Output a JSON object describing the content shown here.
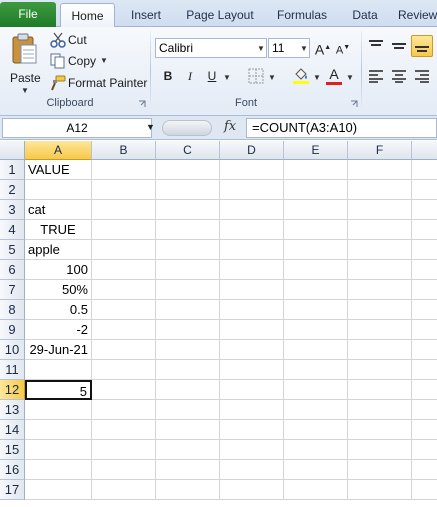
{
  "tabs": [
    {
      "label": "File"
    },
    {
      "label": "Home"
    },
    {
      "label": "Insert"
    },
    {
      "label": "Page Layout"
    },
    {
      "label": "Formulas"
    },
    {
      "label": "Data"
    },
    {
      "label": "Review"
    }
  ],
  "clipboard": {
    "paste_label": "Paste",
    "cut_label": "Cut",
    "copy_label": "Copy",
    "format_painter_label": "Format Painter",
    "group_label": "Clipboard"
  },
  "font": {
    "font_name": "Calibri",
    "font_size": "11",
    "group_label": "Font",
    "bold": "B",
    "italic": "I",
    "underline": "U",
    "grow": "A",
    "shrink": "A",
    "font_color_letter": "A"
  },
  "colors": {
    "file_tab": "#2a8a33",
    "selection_header": "#f7c94a",
    "fill_yellow": "#ffff00",
    "font_red": "#e02020"
  },
  "formula_bar": {
    "name_box": "A12",
    "fx_label": "fx",
    "formula": "=COUNT(A3:A10)"
  },
  "columns": [
    "A",
    "B",
    "C",
    "D",
    "E",
    "F"
  ],
  "rows": [
    {
      "num": "1",
      "a": "VALUE",
      "align": "left"
    },
    {
      "num": "2",
      "a": "",
      "align": "left"
    },
    {
      "num": "3",
      "a": "cat",
      "align": "left"
    },
    {
      "num": "4",
      "a": "TRUE",
      "align": "center"
    },
    {
      "num": "5",
      "a": "apple",
      "align": "left"
    },
    {
      "num": "6",
      "a": "100",
      "align": "right"
    },
    {
      "num": "7",
      "a": "50%",
      "align": "right"
    },
    {
      "num": "8",
      "a": "0.5",
      "align": "right"
    },
    {
      "num": "9",
      "a": "-2",
      "align": "right"
    },
    {
      "num": "10",
      "a": "29-Jun-21",
      "align": "right"
    },
    {
      "num": "11",
      "a": "",
      "align": "left"
    },
    {
      "num": "12",
      "a": "5",
      "align": "right"
    },
    {
      "num": "13",
      "a": "",
      "align": "left"
    },
    {
      "num": "14",
      "a": "",
      "align": "left"
    },
    {
      "num": "15",
      "a": "",
      "align": "left"
    },
    {
      "num": "16",
      "a": "",
      "align": "left"
    },
    {
      "num": "17",
      "a": "",
      "align": "left"
    }
  ],
  "active_cell": {
    "column": "A",
    "row": "12"
  }
}
